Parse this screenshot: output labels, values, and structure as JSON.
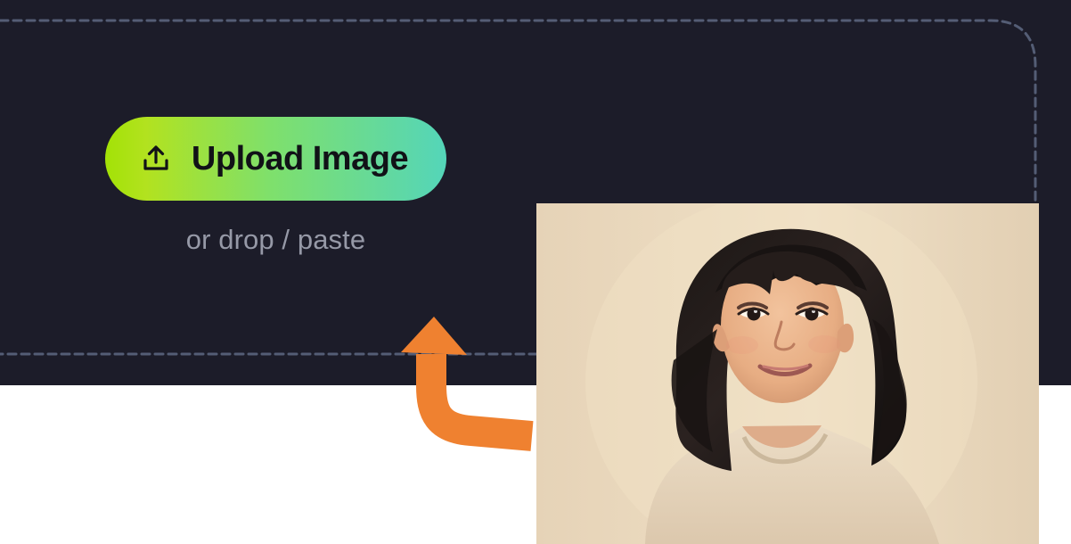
{
  "upload": {
    "button_label": "Upload Image",
    "button_icon": "upload-icon",
    "hint": "or drop / paste",
    "button_gradient_start": "#a3e206",
    "button_gradient_end": "#54d5b9"
  },
  "theme": {
    "background": "#1c1c29",
    "border": "#545d75",
    "hint_text": "#9699a7",
    "arrow": "#ef8130"
  },
  "preview": {
    "icon": "portrait-image",
    "description_visible": false
  },
  "annotation": {
    "icon": "curved-arrow-icon"
  }
}
